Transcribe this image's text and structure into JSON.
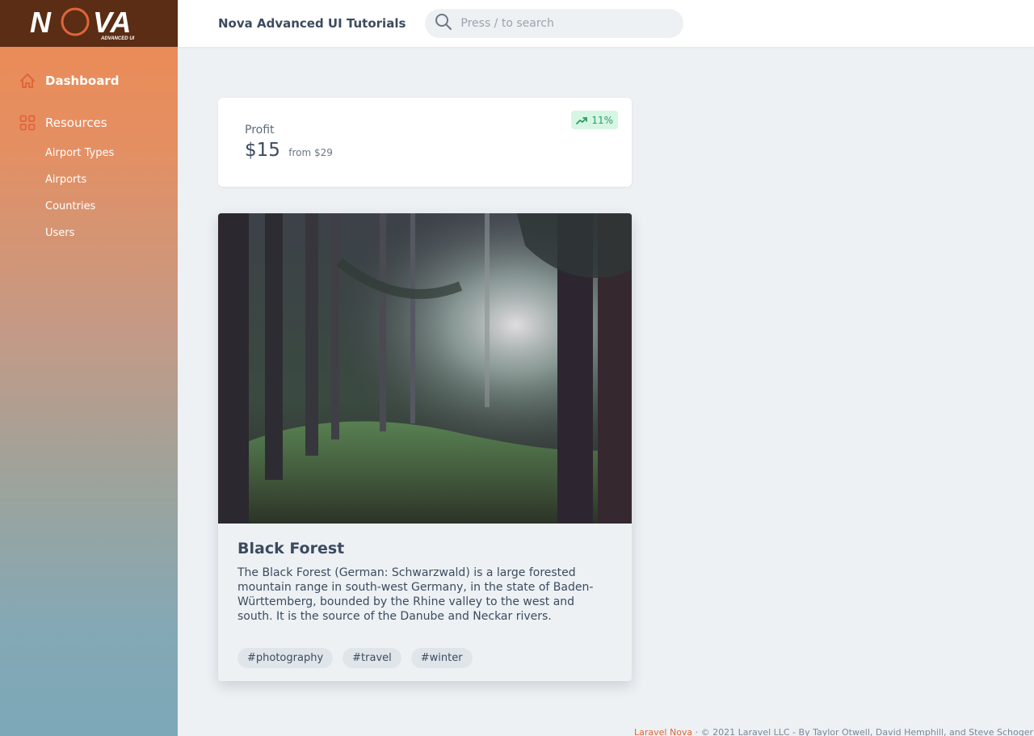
{
  "app": {
    "title": "Nova Advanced UI Tutorials",
    "logo_text": "NOVA",
    "logo_subtext": "ADVANCED UI"
  },
  "search": {
    "placeholder": "Press / to search",
    "value": ""
  },
  "sidebar": {
    "dashboard_label": "Dashboard",
    "resources_label": "Resources",
    "resources": [
      {
        "label": "Airport Types"
      },
      {
        "label": "Airports"
      },
      {
        "label": "Countries"
      },
      {
        "label": "Users"
      }
    ]
  },
  "metric": {
    "title": "Profit",
    "value": "$15",
    "previous": "from $29",
    "change": "11%",
    "change_color": "#2f9b63"
  },
  "card": {
    "title": "Black Forest",
    "description": "The Black Forest (German: Schwarzwald) is a large forested mountain range in south-west Germany, in the state of Baden-Württemberg, bounded by the Rhine valley to the west and south. It is the source of the Danube and Neckar rivers.",
    "tags": [
      "#photography",
      "#travel",
      "#winter"
    ]
  },
  "footer": {
    "link_text": "Laravel Nova",
    "separator": "·",
    "copyright": "© 2021 Laravel LLC - By Taylor Otwell, David Hemphill, and Steve Schoger"
  },
  "colors": {
    "accent": "#e1653a",
    "logo_bg": "#5b2d15",
    "page_bg": "#edf1f4"
  }
}
